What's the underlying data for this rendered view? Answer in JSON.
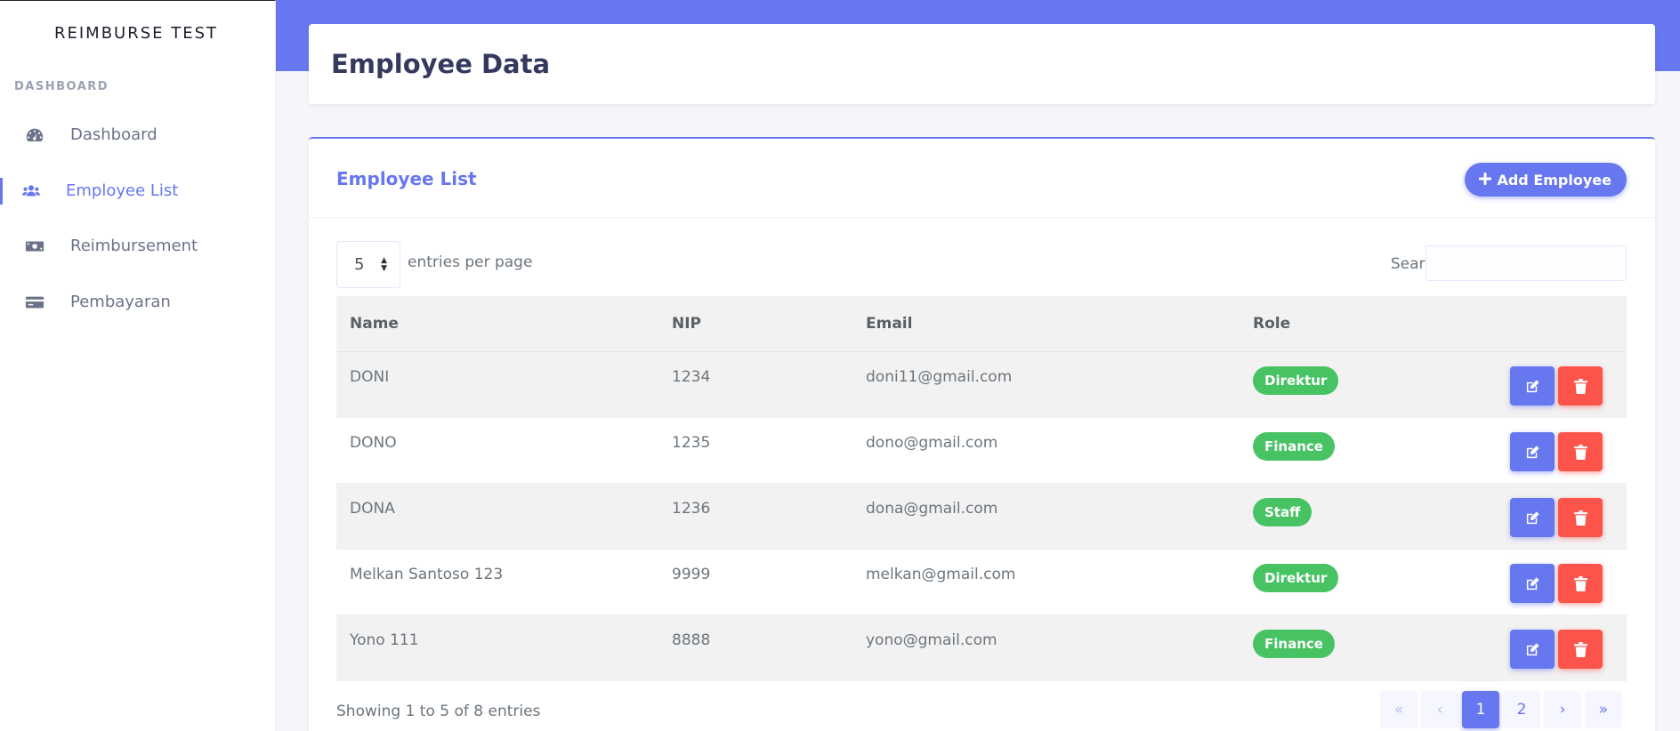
{
  "sidebar": {
    "brand": "REIMBURSE TEST",
    "section_label": "DASHBOARD",
    "items": [
      {
        "label": "Dashboard",
        "icon": "tachometer-icon"
      },
      {
        "label": "Employee List",
        "icon": "users-icon",
        "active": true
      },
      {
        "label": "Reimbursement",
        "icon": "money-bill-icon"
      },
      {
        "label": "Pembayaran",
        "icon": "credit-card-icon"
      }
    ]
  },
  "header": {
    "title": "Employee Data"
  },
  "card": {
    "title": "Employee List",
    "add_button_label": "Add Employee",
    "entries_value": "5",
    "entries_label": "entries per page",
    "search_label": "Search:",
    "search_value": ""
  },
  "table": {
    "columns": [
      "Name",
      "NIP",
      "Email",
      "Role"
    ],
    "rows": [
      {
        "name": "DONI",
        "nip": "1234",
        "email": "doni11@gmail.com",
        "role": "Direktur"
      },
      {
        "name": "DONO",
        "nip": "1235",
        "email": "dono@gmail.com",
        "role": "Finance"
      },
      {
        "name": "DONA",
        "nip": "1236",
        "email": "dona@gmail.com",
        "role": "Staff"
      },
      {
        "name": "Melkan Santoso 123",
        "nip": "9999",
        "email": "melkan@gmail.com",
        "role": "Direktur"
      },
      {
        "name": "Yono 111",
        "nip": "8888",
        "email": "yono@gmail.com",
        "role": "Finance"
      }
    ]
  },
  "footer": {
    "showing": "Showing 1 to 5 of 8 entries",
    "pager": [
      "«",
      "‹",
      "1",
      "2",
      "›",
      "»"
    ],
    "current_page": "1"
  },
  "colors": {
    "primary": "#6777ef",
    "success": "#47c363",
    "danger": "#fc544b"
  }
}
